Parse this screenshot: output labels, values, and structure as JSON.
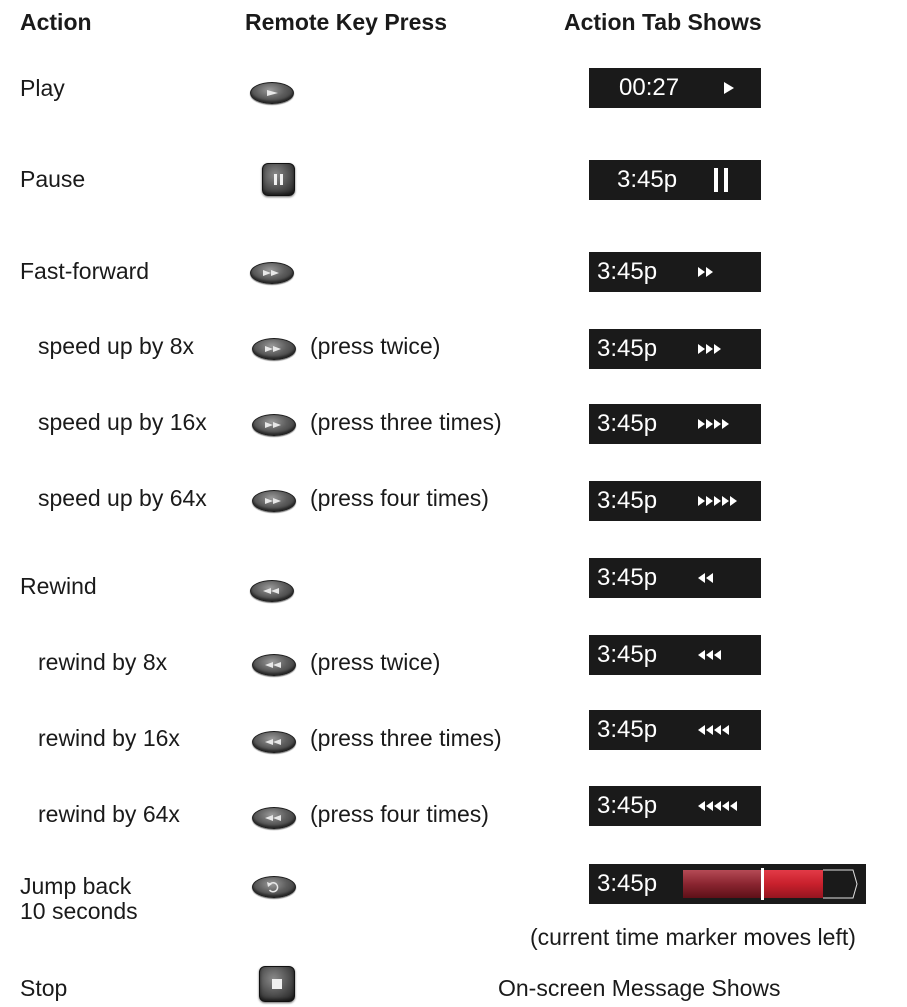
{
  "headers": {
    "action": "Action",
    "remote": "Remote Key Press",
    "tab": "Action Tab Shows"
  },
  "rows": {
    "play": {
      "label": "Play",
      "time": "00:27",
      "icon": "play-icon"
    },
    "pause": {
      "label": "Pause",
      "time": "3:45p",
      "icon": "pause-icon"
    },
    "ff": {
      "label": "Fast-forward",
      "time": "3:45p",
      "icon": "fast-forward-2-icon"
    },
    "ff8": {
      "label": "speed up by 8x",
      "note": "(press twice)",
      "time": "3:45p",
      "icon": "fast-forward-3-icon"
    },
    "ff16": {
      "label": "speed up by 16x",
      "note": "(press three times)",
      "time": "3:45p",
      "icon": "fast-forward-4-icon"
    },
    "ff64": {
      "label": "speed up by 64x",
      "note": "(press four times)",
      "time": "3:45p",
      "icon": "fast-forward-5-icon"
    },
    "rw": {
      "label": "Rewind",
      "time": "3:45p",
      "icon": "rewind-2-icon"
    },
    "rw8": {
      "label": "rewind by 8x",
      "note": "(press twice)",
      "time": "3:45p",
      "icon": "rewind-3-icon"
    },
    "rw16": {
      "label": "rewind by 16x",
      "note": "(press three times)",
      "time": "3:45p",
      "icon": "rewind-4-icon"
    },
    "rw64": {
      "label": "rewind by 64x",
      "note": "(press four times)",
      "time": "3:45p",
      "icon": "rewind-5-icon"
    },
    "jump": {
      "label_line1": "Jump back",
      "label_line2": "10 seconds",
      "time": "3:45p",
      "icon": "progress-bar-icon",
      "caption": "(current time marker moves left)"
    },
    "stop": {
      "label": "Stop",
      "message_heading": "On-screen Message Shows"
    }
  },
  "colors": {
    "tab_bg": "#1a1a1a",
    "tab_text": "#ffffff",
    "progress_red": "#c8202c",
    "progress_dark_red": "#7e1a22"
  }
}
